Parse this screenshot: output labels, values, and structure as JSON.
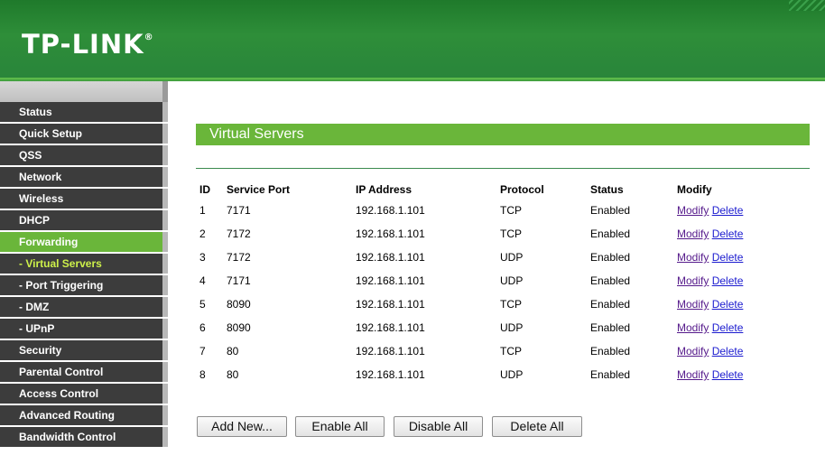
{
  "header": {
    "brand": "TP-LINK",
    "brand_mark": "®"
  },
  "sidebar": {
    "items": [
      {
        "label": "Status"
      },
      {
        "label": "Quick Setup"
      },
      {
        "label": "QSS"
      },
      {
        "label": "Network"
      },
      {
        "label": "Wireless"
      },
      {
        "label": "DHCP"
      },
      {
        "label": "Forwarding",
        "state": "active-parent"
      },
      {
        "label": "- Virtual Servers",
        "state": "active-sub"
      },
      {
        "label": "- Port Triggering"
      },
      {
        "label": "- DMZ"
      },
      {
        "label": "- UPnP"
      },
      {
        "label": "Security"
      },
      {
        "label": "Parental Control"
      },
      {
        "label": "Access Control"
      },
      {
        "label": "Advanced Routing"
      },
      {
        "label": "Bandwidth Control"
      }
    ]
  },
  "main": {
    "title": "Virtual Servers",
    "table": {
      "headers": {
        "id": "ID",
        "port": "Service Port",
        "ip": "IP Address",
        "protocol": "Protocol",
        "status": "Status",
        "modify": "Modify"
      },
      "rows": [
        {
          "id": "1",
          "port": "7171",
          "ip": "192.168.1.101",
          "protocol": "TCP",
          "status": "Enabled",
          "modify": "Modify",
          "delete": "Delete"
        },
        {
          "id": "2",
          "port": "7172",
          "ip": "192.168.1.101",
          "protocol": "TCP",
          "status": "Enabled",
          "modify": "Modify",
          "delete": "Delete"
        },
        {
          "id": "3",
          "port": "7172",
          "ip": "192.168.1.101",
          "protocol": "UDP",
          "status": "Enabled",
          "modify": "Modify",
          "delete": "Delete"
        },
        {
          "id": "4",
          "port": "7171",
          "ip": "192.168.1.101",
          "protocol": "UDP",
          "status": "Enabled",
          "modify": "Modify",
          "delete": "Delete"
        },
        {
          "id": "5",
          "port": "8090",
          "ip": "192.168.1.101",
          "protocol": "TCP",
          "status": "Enabled",
          "modify": "Modify",
          "delete": "Delete"
        },
        {
          "id": "6",
          "port": "8090",
          "ip": "192.168.1.101",
          "protocol": "UDP",
          "status": "Enabled",
          "modify": "Modify",
          "delete": "Delete"
        },
        {
          "id": "7",
          "port": "80",
          "ip": "192.168.1.101",
          "protocol": "TCP",
          "status": "Enabled",
          "modify": "Modify",
          "delete": "Delete"
        },
        {
          "id": "8",
          "port": "80",
          "ip": "192.168.1.101",
          "protocol": "UDP",
          "status": "Enabled",
          "modify": "Modify",
          "delete": "Delete"
        }
      ]
    },
    "buttons": {
      "add_new": "Add New...",
      "enable_all": "Enable All",
      "disable_all": "Disable All",
      "delete_all": "Delete All"
    }
  },
  "colors": {
    "header_green": "#2e8e39",
    "accent_green": "#6ab63a",
    "menu_dark": "#3c3c3c",
    "active_sub_text": "#cdf04a"
  }
}
